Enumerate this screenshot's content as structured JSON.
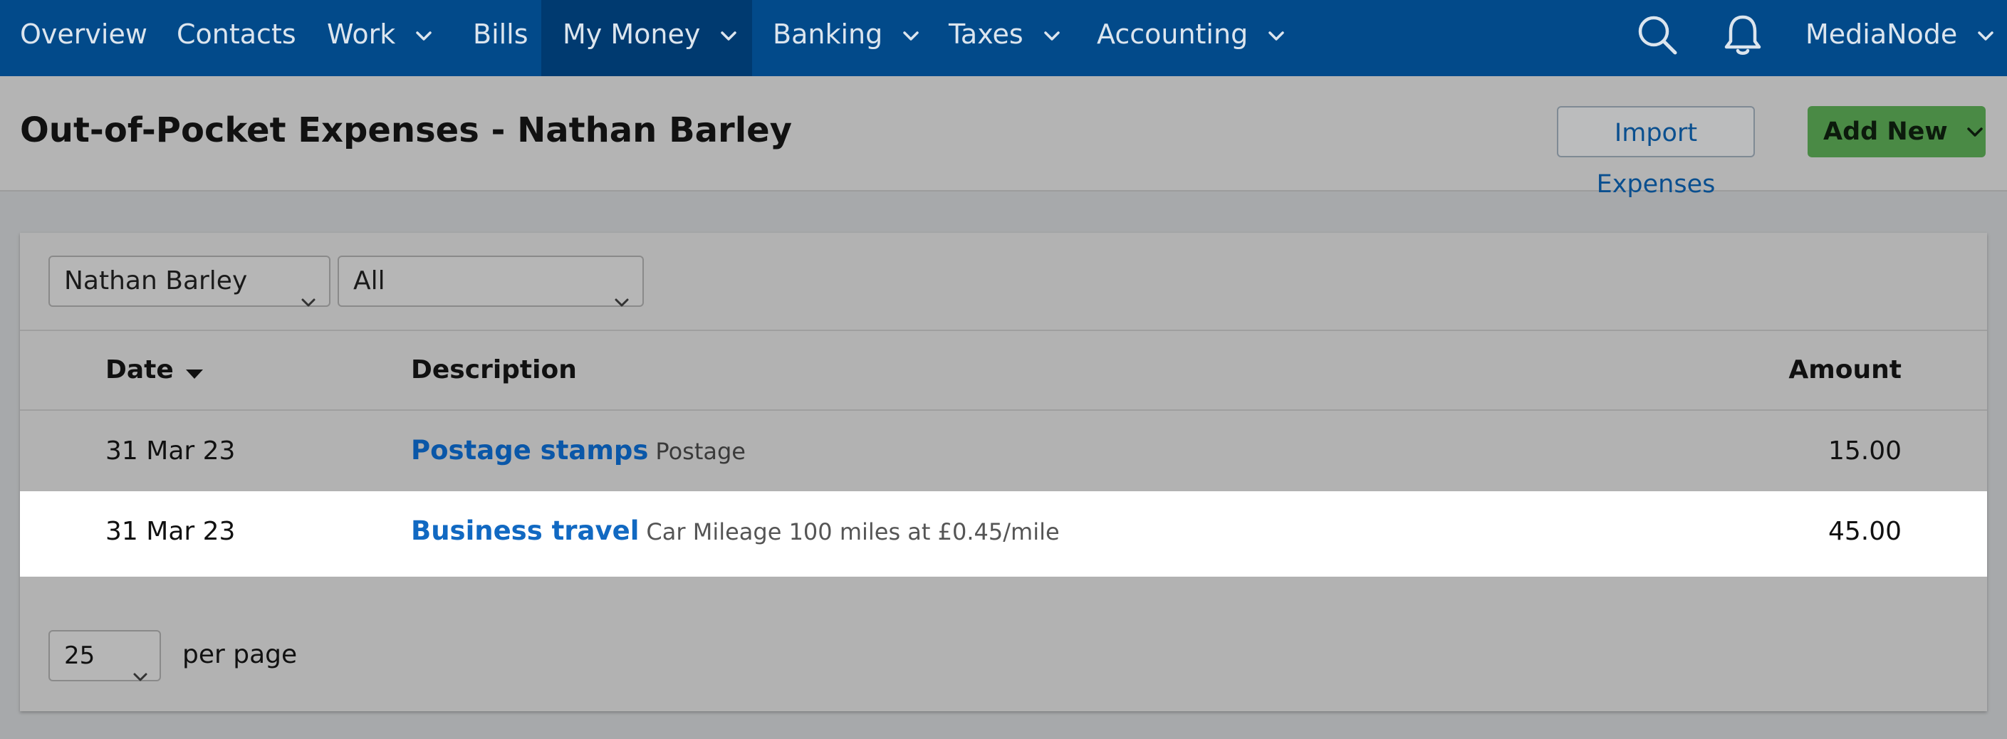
{
  "nav": {
    "items": [
      {
        "label": "Overview",
        "has_menu": false
      },
      {
        "label": "Contacts",
        "has_menu": false
      },
      {
        "label": "Work",
        "has_menu": true
      },
      {
        "label": "Bills",
        "has_menu": false
      },
      {
        "label": "My Money",
        "has_menu": true,
        "active": true
      },
      {
        "label": "Banking",
        "has_menu": true
      },
      {
        "label": "Taxes",
        "has_menu": true
      },
      {
        "label": "Accounting",
        "has_menu": true
      }
    ],
    "icons": [
      "search-icon",
      "bell-icon"
    ],
    "account_label": "MediaNode"
  },
  "header": {
    "title": "Out-of-Pocket Expenses - Nathan Barley",
    "import_label": "Import Expenses",
    "add_label": "Add New"
  },
  "filters": {
    "person": "Nathan Barley",
    "type": "All"
  },
  "table": {
    "columns": {
      "date": "Date",
      "description": "Description",
      "amount": "Amount"
    },
    "rows": [
      {
        "date": "31 Mar 23",
        "title": "Postage stamps",
        "detail": "Postage",
        "amount": "15.00"
      },
      {
        "date": "31 Mar 23",
        "title": "Business travel",
        "detail": "Car Mileage 100 miles at £0.45/mile",
        "amount": "45.00"
      }
    ]
  },
  "pagination": {
    "per_page_value": "25",
    "per_page_label": "per page"
  },
  "colors": {
    "nav_bg": "#024a8a",
    "nav_active": "#003a70",
    "link": "#0a57a8",
    "add_button": "#4a8a45"
  }
}
